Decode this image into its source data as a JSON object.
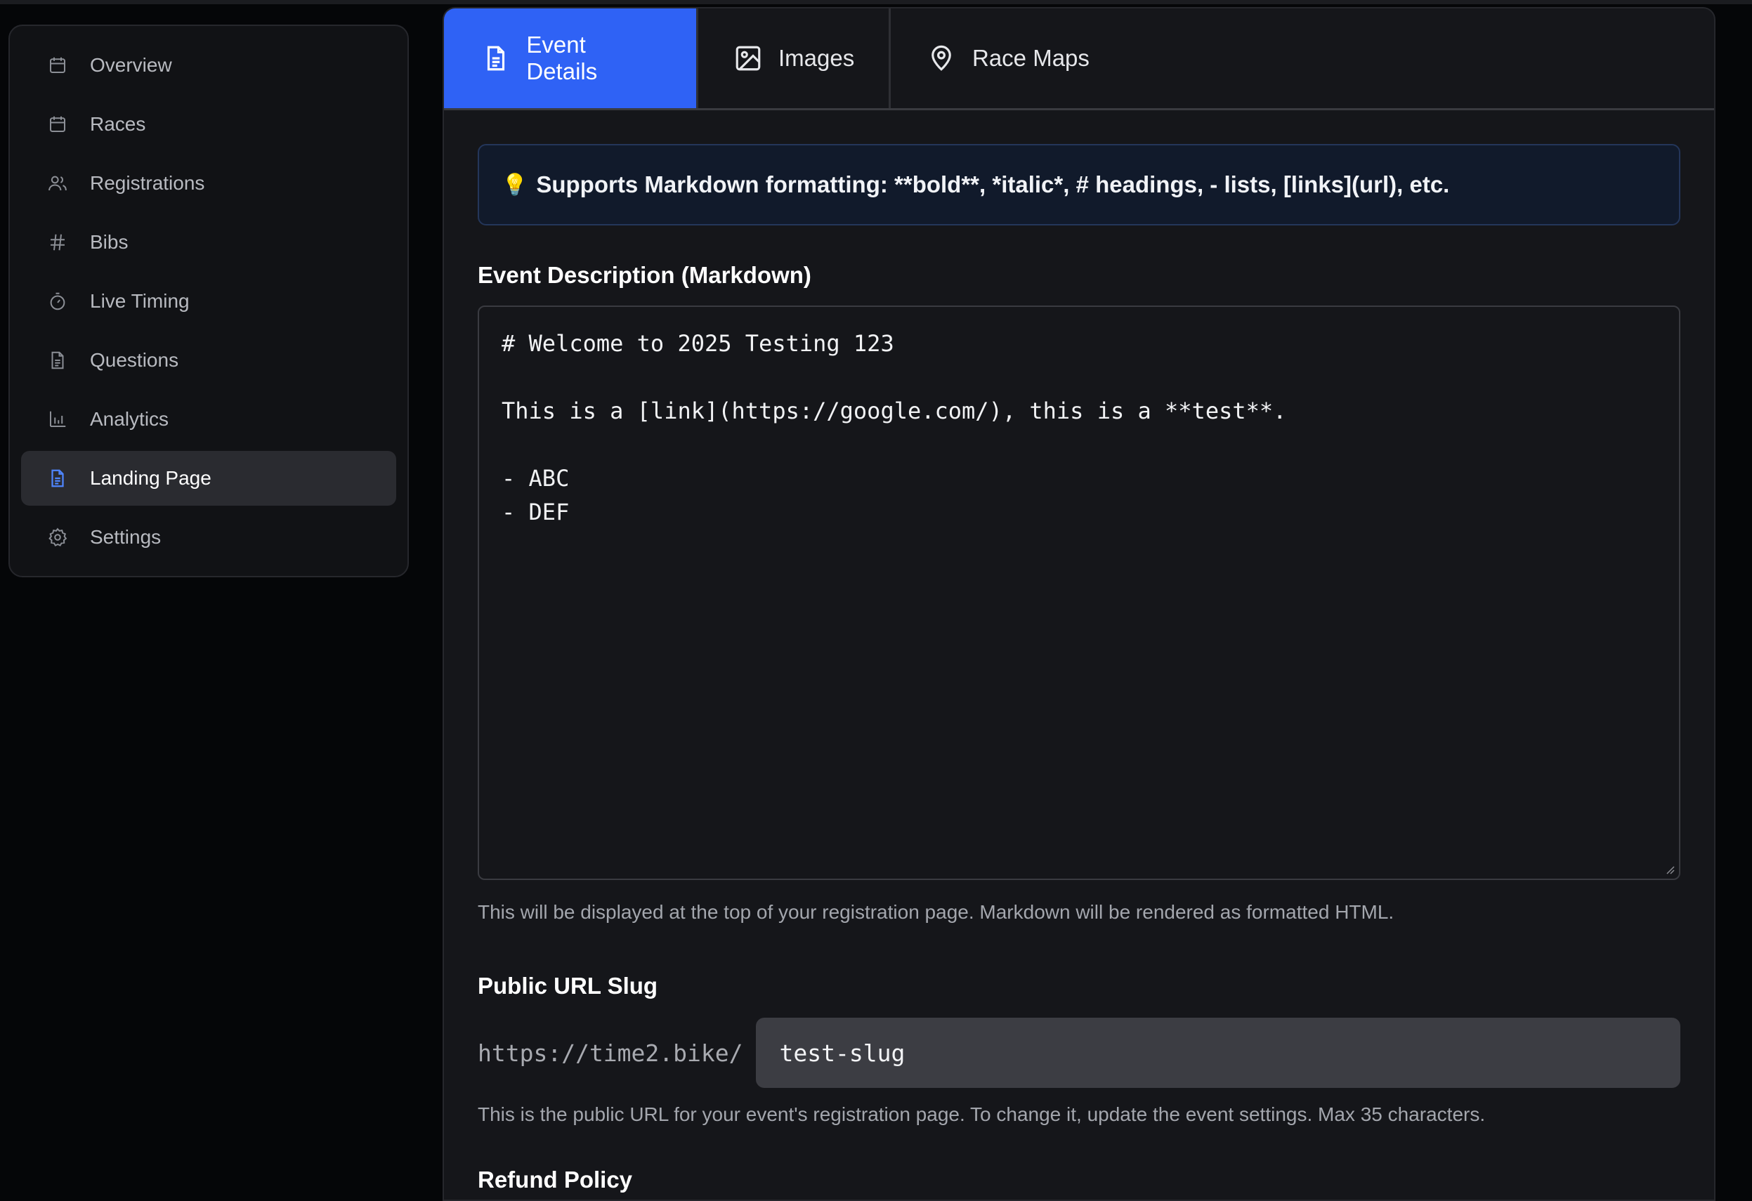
{
  "sidebar": {
    "items": [
      {
        "label": "Overview",
        "icon": "calendar-icon"
      },
      {
        "label": "Races",
        "icon": "calendar-icon"
      },
      {
        "label": "Registrations",
        "icon": "users-icon"
      },
      {
        "label": "Bibs",
        "icon": "hash-icon"
      },
      {
        "label": "Live Timing",
        "icon": "timer-icon"
      },
      {
        "label": "Questions",
        "icon": "document-icon"
      },
      {
        "label": "Analytics",
        "icon": "bar-chart-icon"
      },
      {
        "label": "Landing Page",
        "icon": "document-icon",
        "active": true
      },
      {
        "label": "Settings",
        "icon": "gear-icon"
      }
    ]
  },
  "tabs": [
    {
      "label": "Event Details",
      "icon": "document-icon",
      "active": true
    },
    {
      "label": "Images",
      "icon": "image-icon"
    },
    {
      "label": "Race Maps",
      "icon": "map-pin-icon"
    }
  ],
  "tip": {
    "icon": "lightbulb-icon",
    "text": "Supports Markdown formatting: **bold**, *italic*, # headings, - lists, [links](url), etc."
  },
  "description": {
    "label": "Event Description (Markdown)",
    "value": "# Welcome to 2025 Testing 123\n\nThis is a [link](https://google.com/), this is a **test**.\n\n- ABC\n- DEF",
    "help": "This will be displayed at the top of your registration page. Markdown will be rendered as formatted HTML."
  },
  "slug": {
    "label": "Public URL Slug",
    "prefix": "https://time2.bike/",
    "value": "test-slug",
    "help": "This is the public URL for your event's registration page. To change it, update the event settings. Max 35 characters."
  },
  "refund": {
    "label": "Refund Policy"
  },
  "colors": {
    "accent": "#2f62f5",
    "active_icon": "#4f86ff",
    "background": "#050608",
    "panel": "#15161a"
  }
}
